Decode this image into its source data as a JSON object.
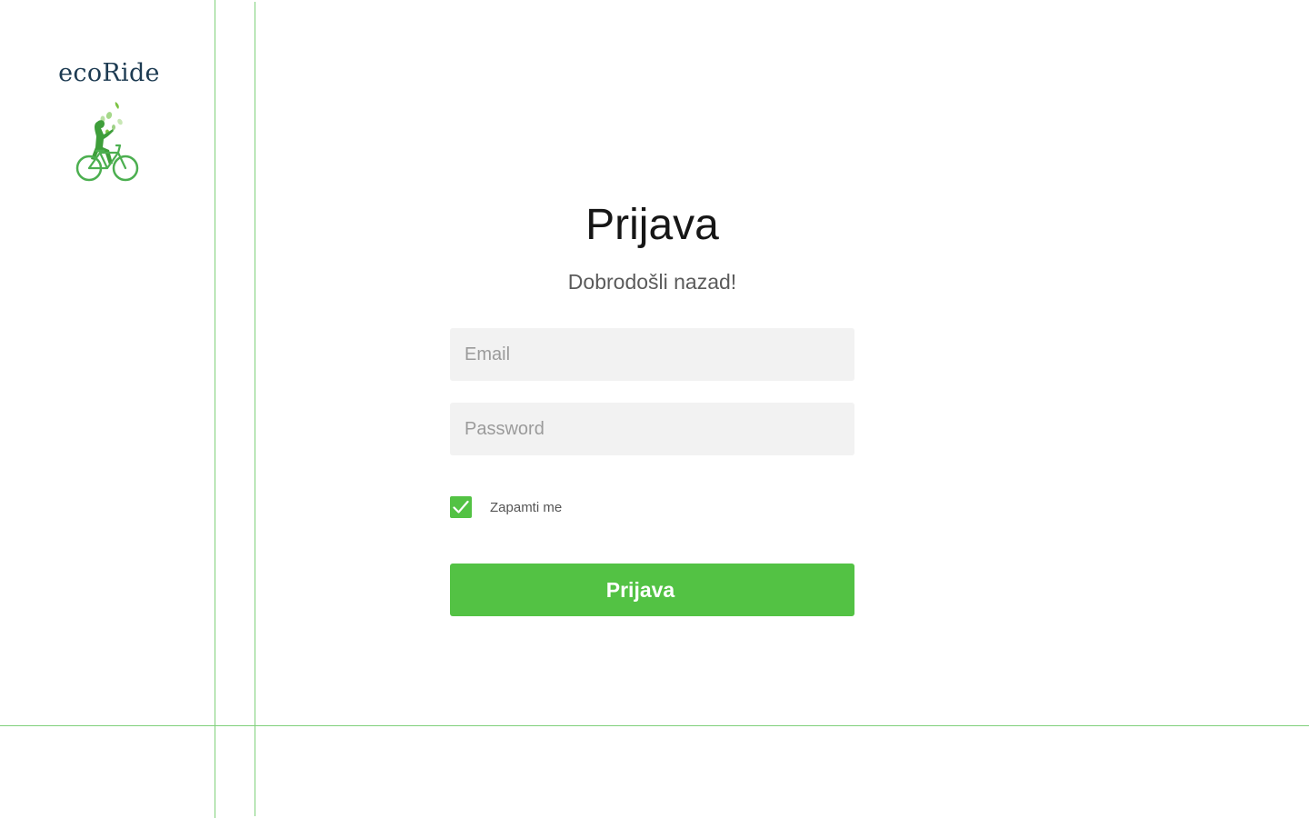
{
  "brand": {
    "name": "ecoRide",
    "logo_icon": "cyclist-leaves-logo",
    "name_color": "#1d3b52",
    "logo_color": "#4caf50"
  },
  "login": {
    "title": "Prijava",
    "subtitle": "Dobrodošli nazad!",
    "email_placeholder": "Email",
    "password_placeholder": "Password",
    "remember_label": "Zapamti me",
    "remember_checked": true,
    "submit_label": "Prijava"
  },
  "colors": {
    "accent": "#53c244",
    "guide_lines": "#7fd07a",
    "field_background": "#f2f2f2"
  }
}
